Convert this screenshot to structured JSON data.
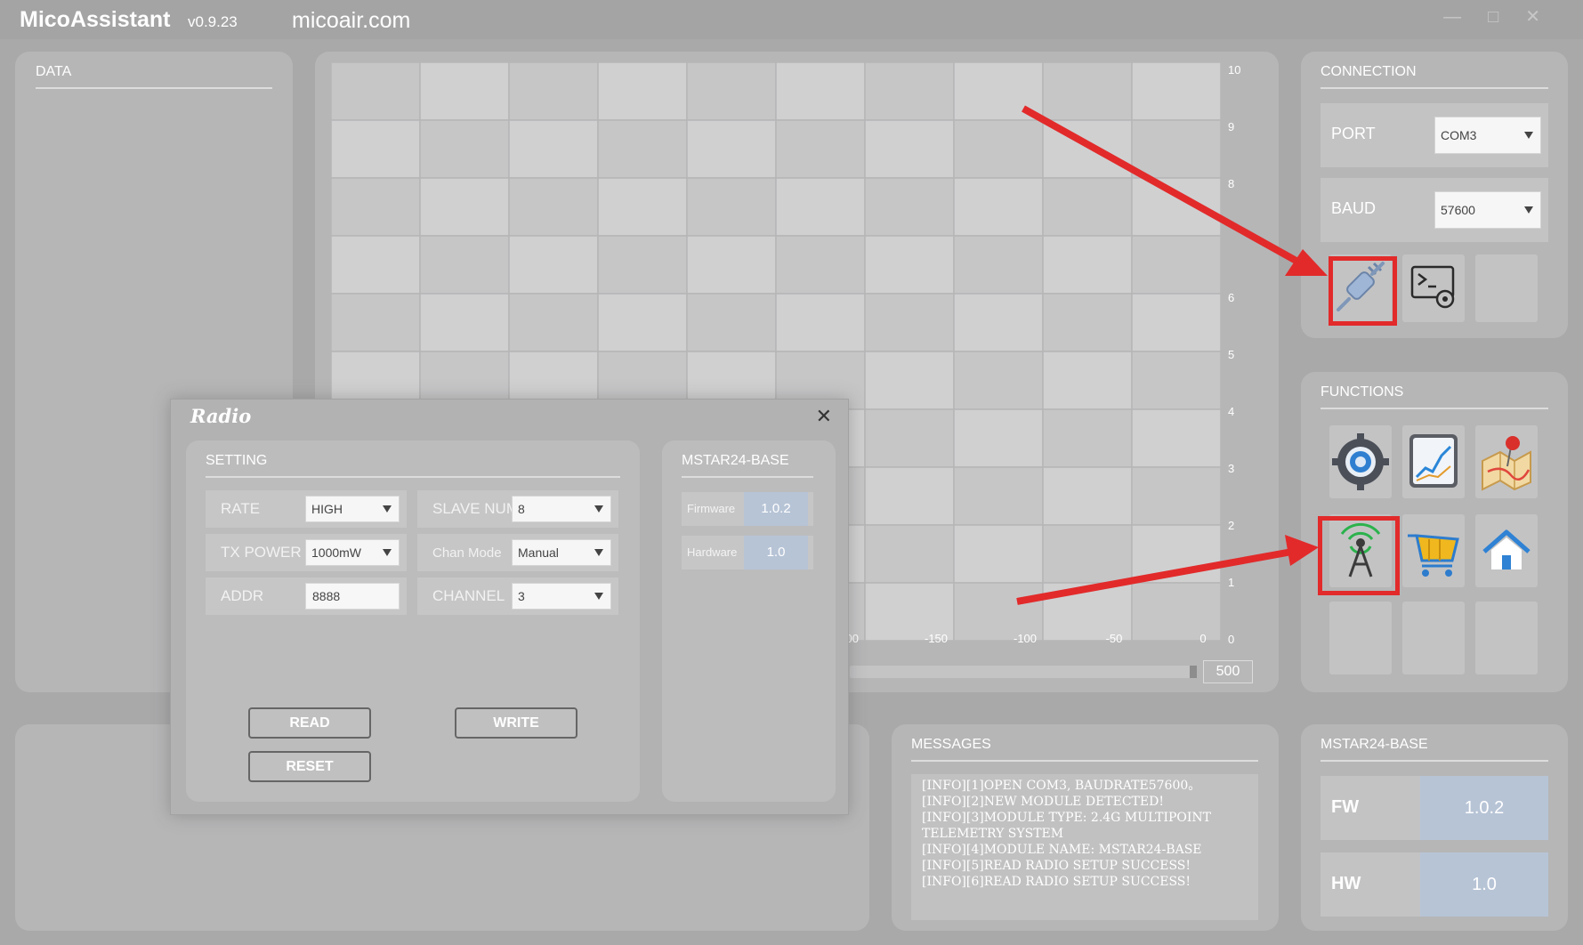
{
  "app": {
    "name": "MicoAssistant",
    "version": "v0.9.23",
    "site": "micoair.com"
  },
  "window_controls": {
    "minimize": "—",
    "maximize": "□",
    "close": "✕"
  },
  "data_panel": {
    "title": "DATA"
  },
  "chart": {
    "y_ticks": [
      "0",
      "1",
      "2",
      "3",
      "4",
      "5",
      "6",
      "8",
      "9",
      "10"
    ],
    "x_ticks": [
      "-200",
      "-150",
      "-100",
      "-50",
      "0"
    ],
    "span_value": "500"
  },
  "chart_data": {
    "type": "line",
    "series": [],
    "x_ticks": [
      "-200",
      "-150",
      "-100",
      "-50",
      "0"
    ],
    "ylim": [
      0,
      10
    ],
    "grid": true
  },
  "connection": {
    "title": "CONNECTION",
    "port_label": "PORT",
    "port_value": "COM3",
    "baud_label": "BAUD",
    "baud_value": "57600",
    "icons": [
      "plug-connect-icon",
      "terminal-settings-icon",
      "empty-slot"
    ]
  },
  "functions": {
    "title": "FUNCTIONS",
    "icons": [
      "gear-settings-icon",
      "chart-icon",
      "map-pin-icon",
      "radio-antenna-icon",
      "shopping-cart-icon",
      "home-icon"
    ]
  },
  "messages": {
    "title": "MESSAGES",
    "lines": [
      "[INFO][1]OPEN COM3, BAUDRATE57600。",
      "[INFO][2]NEW MODULE DETECTED!",
      "[INFO][3]MODULE TYPE:  2.4G MULTIPOINT",
      "TELEMETRY SYSTEM",
      "[INFO][4]MODULE NAME:  MSTAR24-BASE",
      "[INFO][5]READ RADIO SETUP SUCCESS!",
      "[INFO][6]READ RADIO SETUP SUCCESS!"
    ]
  },
  "base_info": {
    "title": "MSTAR24-BASE",
    "fw_label": "FW",
    "fw_value": "1.0.2",
    "hw_label": "HW",
    "hw_value": "1.0"
  },
  "radio_dialog": {
    "title": "Radio",
    "close": "✕",
    "setting_title": "SETTING",
    "rate_label": "RATE",
    "rate_value": "HIGH",
    "txpower_label": "TX POWER",
    "txpower_value": "1000mW",
    "addr_label": "ADDR",
    "addr_value": "8888",
    "slave_label": "SLAVE NUM",
    "slave_value": "8",
    "chanmode_label": "Chan Mode",
    "chanmode_value": "Manual",
    "channel_label": "CHANNEL",
    "channel_value": "3",
    "read_button": "READ",
    "write_button": "WRITE",
    "reset_button": "RESET",
    "module_title": "MSTAR24-BASE",
    "firmware_label": "Firmware",
    "firmware_value": "1.0.2",
    "hardware_label": "Hardware",
    "hardware_value": "1.0"
  },
  "annotation": {
    "arrow_color": "#e22a2a"
  }
}
